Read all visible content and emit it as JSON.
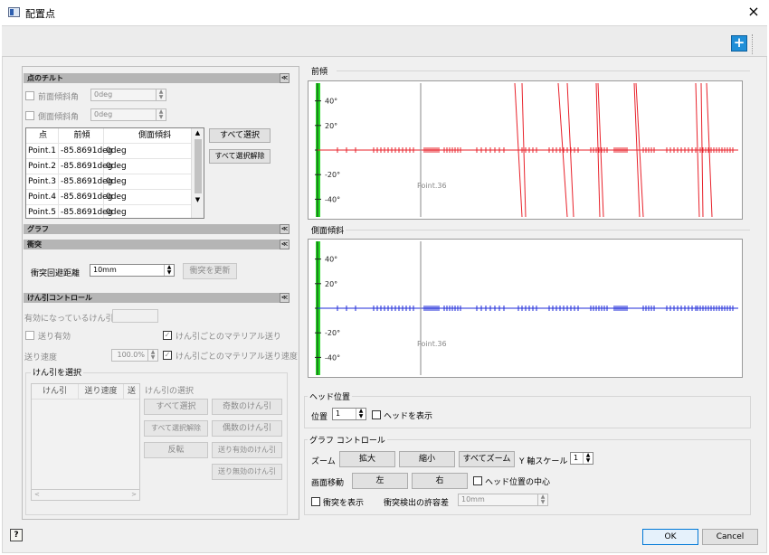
{
  "window": {
    "title": "配置点",
    "close": "×"
  },
  "icons": {
    "app": "app-window-icon",
    "add": "plus-icon",
    "close": "close-icon",
    "help": "help-icon"
  },
  "toolbar": {
    "add_label": "+"
  },
  "tilt": {
    "header": "点のチルト",
    "collapse": "≪",
    "front_label": "前面傾斜角",
    "front_value": "0deg",
    "side_label": "側面傾斜角",
    "side_value": "0deg",
    "columns": [
      "点",
      "前傾",
      "側面傾斜"
    ],
    "rows": [
      [
        "Point.1",
        "-85.8691deg",
        "0deg"
      ],
      [
        "Point.2",
        "-85.8691deg",
        "0deg"
      ],
      [
        "Point.3",
        "-85.8691deg",
        "0deg"
      ],
      [
        "Point.4",
        "-85.8691deg",
        "0deg"
      ],
      [
        "Point.5",
        "-85.8691deg",
        "0deg"
      ]
    ],
    "select_all": "すべて選択",
    "deselect_all": "すべて選択解除"
  },
  "graph_section": {
    "header": "グラフ",
    "toggle": "≪"
  },
  "collision": {
    "header": "衝突",
    "collapse": "≪",
    "distance_label": "衝突回避距離",
    "distance_value": "10mm",
    "update": "衝突を更新"
  },
  "cable": {
    "header": "けん引コントロール",
    "collapse": "≪",
    "active_label": "有効になっているけん引",
    "feed_enable": "送り有効",
    "per_material": "けん引ごとのマテリアル送り",
    "feed_speed_label": "送り速度",
    "feed_speed_value": "100.0%",
    "per_material_speed": "けん引ごとのマテリアル送り速度",
    "select_group": "けん引を選択",
    "list_cols": [
      "けん引",
      "送り速度",
      "送"
    ],
    "selection_label": "けん引の選択",
    "buttons": [
      "すべて選択",
      "奇数のけん引",
      "すべて選択解除",
      "偶数のけん引",
      "反転",
      "送り有効のけん引",
      "送り無効のけん引"
    ]
  },
  "front_chart": {
    "title": "前傾",
    "annot": "Point.36"
  },
  "side_chart": {
    "title": "側面傾斜",
    "annot": "Point.36"
  },
  "chart_data": [
    {
      "type": "line",
      "title": "前傾",
      "yticks": [
        "40°",
        "20°",
        "",
        "-20°",
        "-40°"
      ],
      "ylim": [
        -50,
        50
      ],
      "annotation": "Point.36",
      "series": [
        {
          "color": "#e8212a"
        }
      ]
    },
    {
      "type": "line",
      "title": "側面傾斜",
      "yticks": [
        "40°",
        "20°",
        "",
        "-20°",
        "-40°"
      ],
      "ylim": [
        -50,
        50
      ],
      "annotation": "Point.36",
      "series": [
        {
          "color": "#1c2ad8"
        }
      ]
    }
  ],
  "head": {
    "group": "ヘッド位置",
    "pos_label": "位置",
    "pos_value": "1",
    "show": "ヘッドを表示"
  },
  "graph_ctrl": {
    "group": "グラフ コントロール",
    "zoom_label": "ズーム",
    "zoom_in": "拡大",
    "zoom_out": "縮小",
    "zoom_all": "すべてズーム",
    "yscale_label": "Y 軸スケール",
    "yscale_value": "1",
    "pan_label": "画面移動",
    "left": "左",
    "right": "右",
    "center": "ヘッド位置の中心",
    "show_collision": "衝突を表示",
    "tolerance_label": "衝突検出の許容差",
    "tolerance_value": "10mm"
  },
  "footer": {
    "ok": "OK",
    "cancel": "Cancel",
    "help": "?"
  },
  "colors": {
    "red": "#e8212a",
    "blue": "#1c2ad8",
    "green": "#22dd22",
    "accent": "#1f8fd8"
  }
}
